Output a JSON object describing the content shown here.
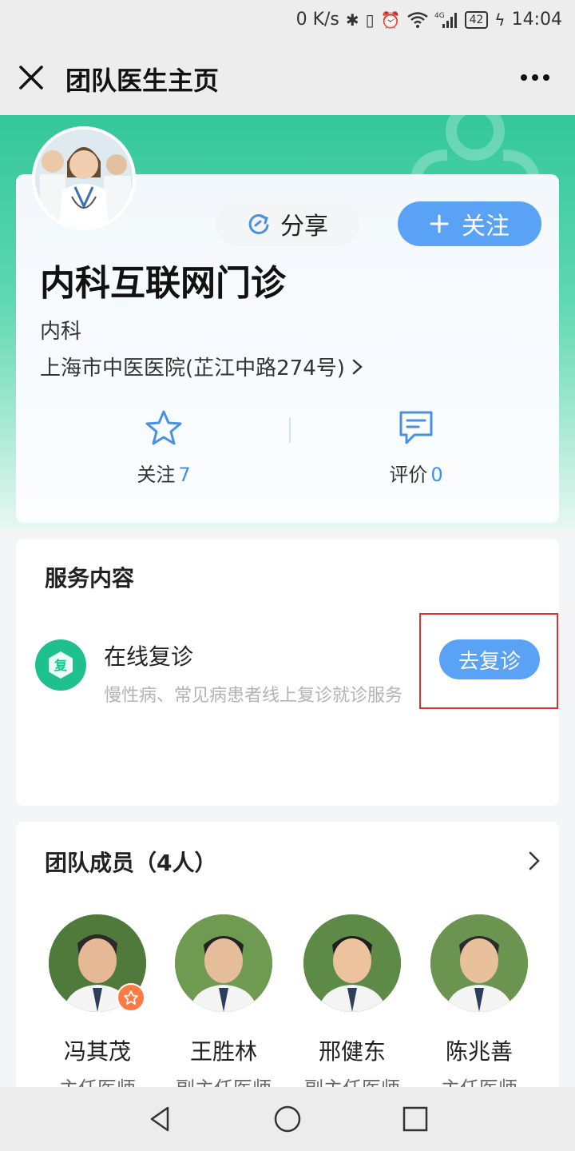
{
  "status_bar": {
    "speed": "0 K/s",
    "signal": "4G",
    "battery": "42",
    "time": "14:04"
  },
  "nav": {
    "title": "团队医生主页"
  },
  "profile": {
    "share_label": "分享",
    "follow_label": "关注",
    "team_name": "内科互联网门诊",
    "department": "内科",
    "hospital": "上海市中医医院(芷江中路274号)",
    "stats": [
      {
        "label": "关注",
        "value": "7"
      },
      {
        "label": "评价",
        "value": "0"
      }
    ]
  },
  "service": {
    "section_title": "服务内容",
    "icon_char": "复",
    "name": "在线复诊",
    "desc": "慢性病、常见病患者线上复诊就诊服务",
    "button_label": "去复诊"
  },
  "team": {
    "section_title": "团队成员（4人）",
    "members": [
      {
        "name": "冯其茂",
        "role": "主任医师"
      },
      {
        "name": "王胜林",
        "role": "副主任医师"
      },
      {
        "name": "邢健东",
        "role": "副主任医师"
      },
      {
        "name": "陈兆善",
        "role": "主任医师"
      }
    ]
  },
  "colors": {
    "accent_blue": "#5aa2f5",
    "brand_green": "#33c79a",
    "highlight_red": "#e03131"
  }
}
